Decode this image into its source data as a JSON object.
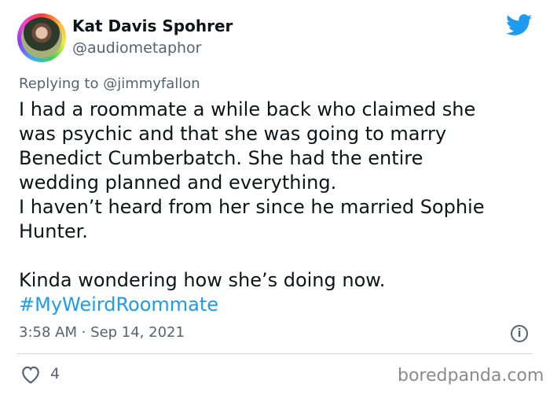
{
  "user": {
    "display_name": "Kat Davis Spohrer",
    "handle": "@audiometaphor"
  },
  "reply": {
    "prefix": "Replying to ",
    "mention": "@jimmyfallon"
  },
  "tweet": {
    "lines": [
      "I had a roommate a while back who claimed she",
      "was psychic and that she was going to marry",
      "Benedict Cumberbatch. She had the entire",
      "wedding planned and everything.",
      "I haven’t heard from her since he married Sophie",
      "Hunter."
    ],
    "closing_line": "Kinda wondering how she’s doing now.",
    "hashtag": "#MyWeirdRoommate"
  },
  "meta": {
    "timestamp": "3:58 AM · Sep 14, 2021"
  },
  "engagement": {
    "like_count": "4"
  },
  "icons": {
    "brand": "twitter-bird-icon",
    "info": "info-icon",
    "like": "heart-icon"
  },
  "colors": {
    "brand_blue": "#1d9bf0",
    "secondary_text": "#536471"
  },
  "watermark": "boredpanda.com"
}
